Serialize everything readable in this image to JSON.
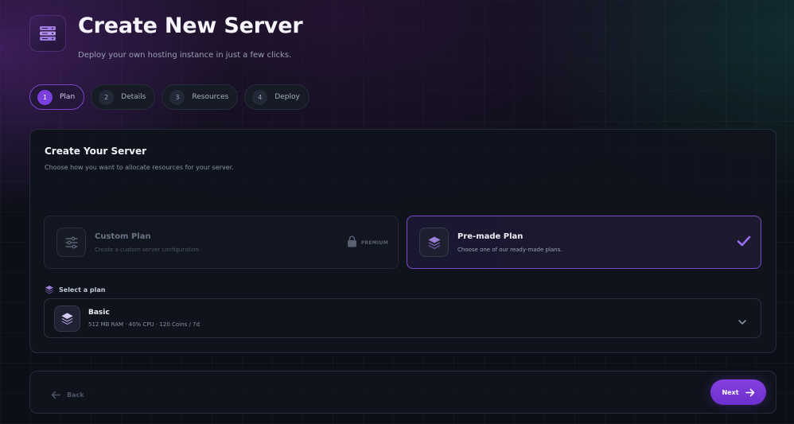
{
  "header": {
    "title": "Create New Server",
    "subtitle": "Deploy your own hosting instance in just a few clicks.",
    "icon": "server-stack-icon"
  },
  "stepper": {
    "steps": [
      {
        "number": "1",
        "label": "Plan",
        "active": true
      },
      {
        "number": "2",
        "label": "Details",
        "active": false
      },
      {
        "number": "3",
        "label": "Resources",
        "active": false
      },
      {
        "number": "4",
        "label": "Deploy",
        "active": false
      }
    ]
  },
  "card": {
    "title": "Create Your Server",
    "description": "Choose how you want to allocate resources for your server.",
    "options": {
      "custom": {
        "name": "Custom Plan",
        "description": "Create a custom server configuration.",
        "badge": "PREMIUM",
        "icon": "sliders-icon",
        "locked": true
      },
      "premade": {
        "name": "Pre-made Plan",
        "description": "Choose one of our ready-made plans.",
        "icon": "layers-icon",
        "selected": true
      }
    },
    "select": {
      "label": "Select a plan",
      "selected_name": "Basic",
      "selected_specs": "512 MB RAM · 40% CPU · 120 Coins / 7d"
    }
  },
  "footer": {
    "back_label": "Back",
    "next_label": "Next"
  },
  "colors": {
    "accent": "#7b3fe0",
    "background": "#0c0f17",
    "card": "#10141d"
  }
}
